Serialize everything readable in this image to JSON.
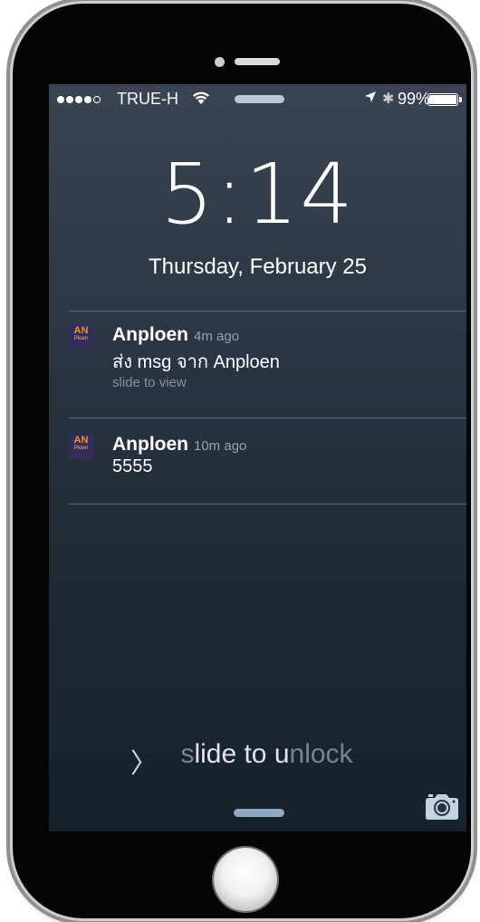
{
  "status_bar": {
    "signal_dots": 4,
    "signal_empty": 1,
    "carrier": "TRUE-H",
    "battery_text": "99%",
    "battery_level": 0.99,
    "icons": [
      "wifi-icon",
      "location-arrow-icon",
      "bluetooth-icon",
      "battery-icon"
    ]
  },
  "lock_screen": {
    "time": "5:14",
    "date": "Thursday, February 25",
    "unlock_text": "slide to unlock",
    "unlock_text_dim_prefix": "s",
    "unlock_text_bright_mid": "lide to u",
    "unlock_text_dim_suffix": "nlock"
  },
  "notifications": [
    {
      "app_name": "Anploen",
      "time_ago": "4m ago",
      "message": "ส่ง msg จาก Anploen",
      "hint": "slide to view",
      "icon_label_top": "AN",
      "icon_label_bottom": "Ploen"
    },
    {
      "app_name": "Anploen",
      "time_ago": "10m ago",
      "message": "5555",
      "icon_label_top": "AN",
      "icon_label_bottom": "Ploen"
    }
  ],
  "colors": {
    "screen_top": "#3a4452",
    "screen_bottom": "#17212b",
    "accent_grabber": "#8fa9c2",
    "icon_orange": "#ff8a2a"
  }
}
